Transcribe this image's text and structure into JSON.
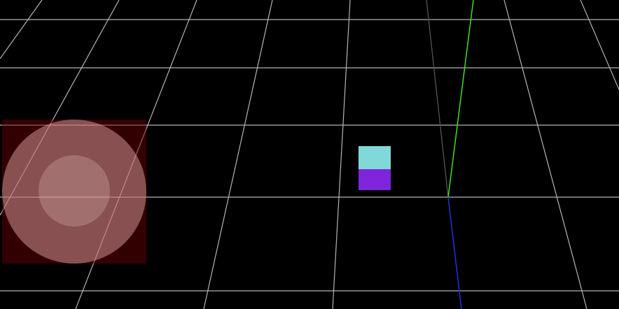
{
  "scene": {
    "background_color": "#000000",
    "grid_color": "#b4b4b4",
    "axes": {
      "y_axis_color": "#44dd22",
      "z_axis_color": "#2233dd",
      "x_axis_color": "#555555"
    },
    "object": {
      "name": "cube",
      "top_color": "#80d8d8",
      "front_color": "#7f25dc"
    }
  },
  "joystick": {
    "zone_color": "#6e0000",
    "base_color": "#ffbebe",
    "knob_color": "#ffe1e1"
  }
}
